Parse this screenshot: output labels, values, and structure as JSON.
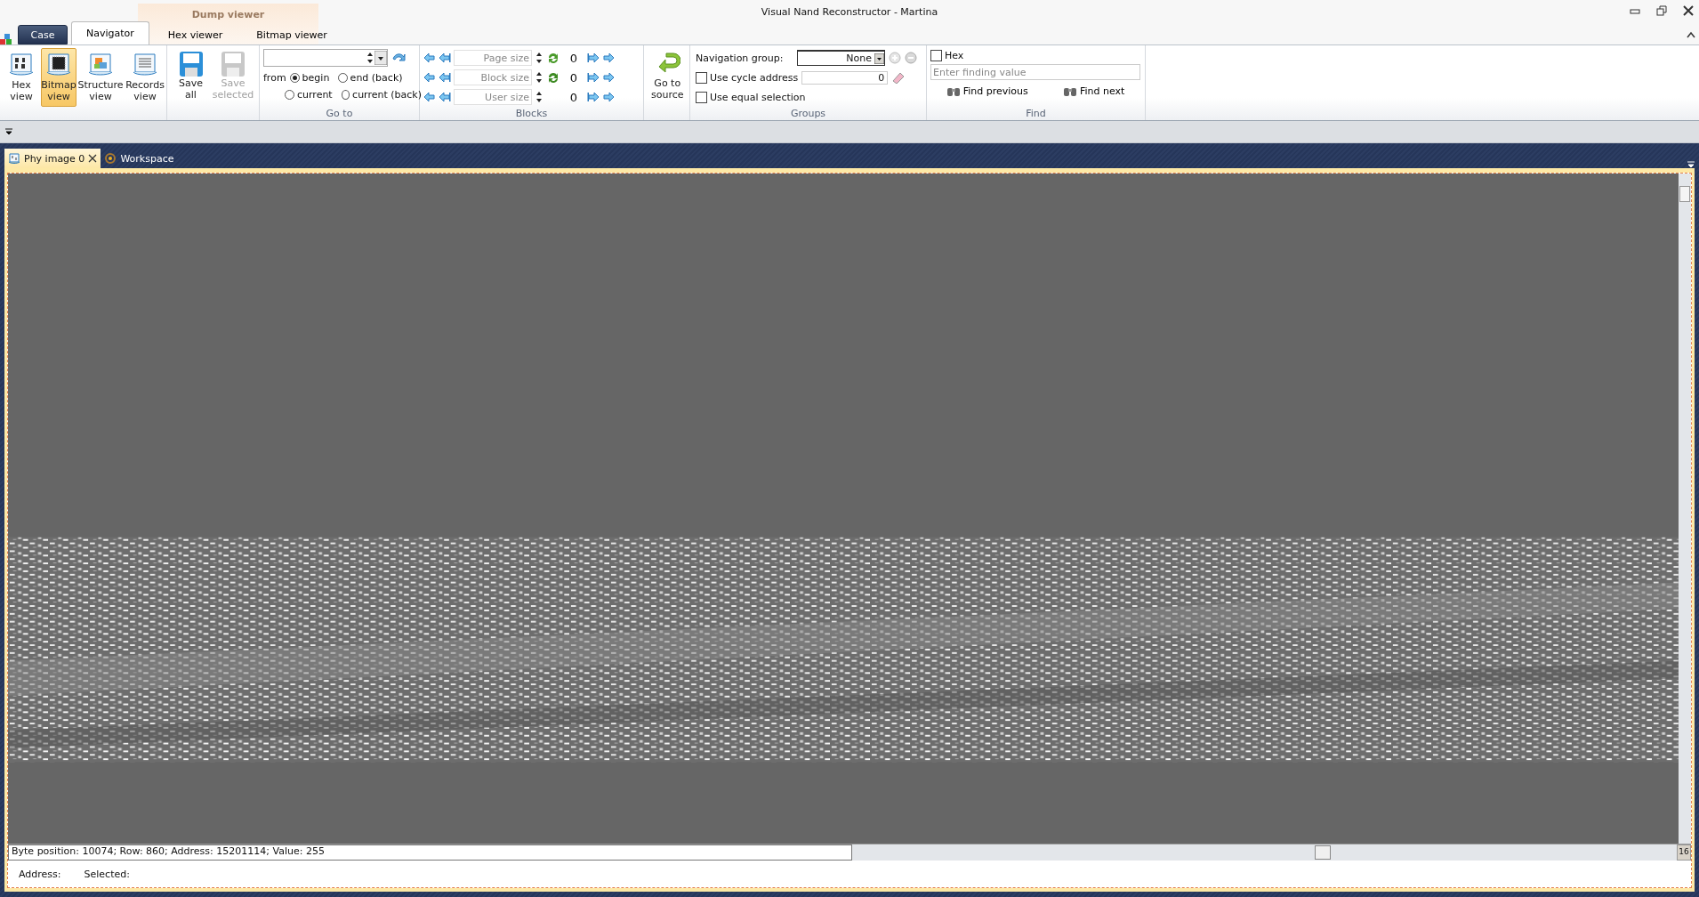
{
  "window": {
    "title": "Visual Nand Reconstructor - Martina"
  },
  "app_menu": {
    "label": "Case"
  },
  "context_group": {
    "label": "Dump viewer"
  },
  "tabs": [
    {
      "label": "Navigator",
      "selected": true
    },
    {
      "label": "Hex viewer",
      "selected": false
    },
    {
      "label": "Bitmap viewer",
      "selected": false
    }
  ],
  "views": [
    {
      "label": "Hex view",
      "kind": "hex",
      "selected": false
    },
    {
      "label": "Bitmap view",
      "kind": "bitmap",
      "selected": true
    },
    {
      "label": "Structure view",
      "kind": "structure",
      "selected": false
    },
    {
      "label": "Records view",
      "kind": "records",
      "selected": false
    }
  ],
  "save": [
    {
      "label": "Save all",
      "disabled": false
    },
    {
      "label": "Save selected",
      "disabled": true
    }
  ],
  "goto": {
    "from_label": "from",
    "radios": [
      {
        "label": "begin",
        "selected": true
      },
      {
        "label": "end (back)",
        "selected": false
      },
      {
        "label": "current",
        "selected": false
      },
      {
        "label": "current (back)",
        "selected": false
      }
    ],
    "group_label": "Go to"
  },
  "blocks": {
    "rows": [
      {
        "placeholder": "Page size",
        "value": "0",
        "kind": "page"
      },
      {
        "placeholder": "Block size",
        "value": "0",
        "kind": "block"
      },
      {
        "placeholder": "User size",
        "value": "0",
        "kind": "user"
      }
    ],
    "group_label": "Blocks"
  },
  "go_to_source": {
    "label": "Go to source"
  },
  "groups": {
    "nav_label": "Navigation group:",
    "nav_value": "None",
    "checks": [
      {
        "label": "Use cycle address",
        "checked": false
      },
      {
        "label": "Use equal selection",
        "checked": false
      }
    ],
    "cycle_value": "0",
    "group_label": "Groups"
  },
  "find": {
    "hex": {
      "label": "Hex",
      "checked": false
    },
    "placeholder": "Enter finding value",
    "buttons": [
      "Find previous",
      "Find next"
    ],
    "group_label": "Find"
  },
  "doc_tabs": [
    {
      "label": "Phy image 0",
      "selected": true
    },
    {
      "label": "Workspace",
      "kind": "workspace",
      "selected": false
    }
  ],
  "status": {
    "info": "Byte position: 10074; Row: 860; Address: 15201114; Value: 255",
    "corner": "16",
    "address_label": "Address:",
    "selected_label": "Selected:"
  }
}
